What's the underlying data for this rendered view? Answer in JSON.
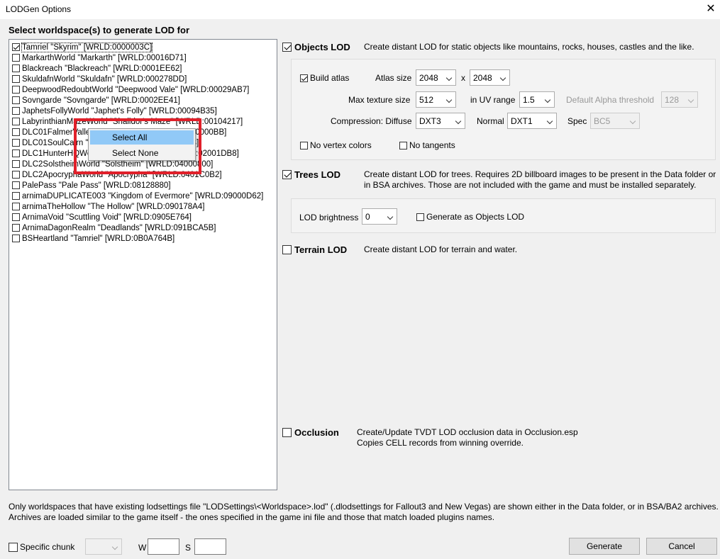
{
  "window": {
    "title": "LODGen Options",
    "close": "✕"
  },
  "worldspaces": {
    "heading": "Select worldspace(s) to generate LOD for",
    "items": [
      {
        "label": "Tamriel \"Skyrim\" [WRLD:0000003C]",
        "checked": true
      },
      {
        "label": "MarkarthWorld \"Markarth\" [WRLD:00016D71]",
        "checked": false
      },
      {
        "label": "Blackreach \"Blackreach\" [WRLD:0001EE62]",
        "checked": false
      },
      {
        "label": "SkuldafnWorld \"Skuldafn\" [WRLD:000278DD]",
        "checked": false
      },
      {
        "label": "DeepwoodRedoubtWorld \"Deepwood Vale\" [WRLD:00029AB7]",
        "checked": false
      },
      {
        "label": "Sovngarde \"Sovngarde\" [WRLD:0002EE41]",
        "checked": false
      },
      {
        "label": "JaphetsFollyWorld \"Japhet's Folly\" [WRLD:00094B35]",
        "checked": false
      },
      {
        "label": "LabyrinthianMazeWorld \"Shalidor's Maze\" [WRLD:00104217]",
        "checked": false
      },
      {
        "label": "DLC01FalmerValley \"Forgotten Vale\" [WRLD:020000BB]",
        "checked": false
      },
      {
        "label": "DLC01SoulCairn \"Soul Cairn\" [WRLD:02001408]",
        "checked": false
      },
      {
        "label": "DLC1HunterHQWorld \"Fort Dawnguard\" [WRLD:02001DB8]",
        "checked": false
      },
      {
        "label": "DLC2SolstheimWorld \"Solstheim\" [WRLD:04000800]",
        "checked": false
      },
      {
        "label": "DLC2ApocryphaWorld \"Apocrypha\" [WRLD:0401C0B2]",
        "checked": false
      },
      {
        "label": "PalePass \"Pale Pass\" [WRLD:08128880]",
        "checked": false
      },
      {
        "label": "arnimaDUPLICATE003 \"Kingdom of Evermore\" [WRLD:09000D62]",
        "checked": false
      },
      {
        "label": "arnimaTheHollow \"The Hollow\" [WRLD:090178A4]",
        "checked": false
      },
      {
        "label": "ArnimaVoid \"Scuttling Void\" [WRLD:0905E764]",
        "checked": false
      },
      {
        "label": "ArnimaDagonRealm \"Deadlands\" [WRLD:091BCA5B]",
        "checked": false
      },
      {
        "label": "BSHeartland \"Tamriel\" [WRLD:0B0A764B]",
        "checked": false
      }
    ]
  },
  "context_menu": {
    "select_all": "Select All",
    "select_none": "Select None"
  },
  "objects_lod": {
    "label": "Objects LOD",
    "checked": true,
    "desc": "Create distant LOD for static objects like mountains, rocks, houses, castles and the like.",
    "build_atlas": "Build atlas",
    "build_atlas_checked": true,
    "atlas_size_label": "Atlas size",
    "atlas_w": "2048",
    "x": "x",
    "atlas_h": "2048",
    "max_tex_label": "Max texture size",
    "max_tex": "512",
    "uv_label": "in UV range",
    "uv": "1.5",
    "alpha_label": "Default Alpha threshold",
    "alpha": "128",
    "comp_label": "Compression: Diffuse",
    "diffuse": "DXT3",
    "normal_label": "Normal",
    "normal": "DXT1",
    "spec_label": "Spec",
    "spec": "BC5",
    "no_vertex": "No vertex colors",
    "no_tangents": "No tangents"
  },
  "trees_lod": {
    "label": "Trees LOD",
    "checked": true,
    "desc1": "Create distant LOD for trees. Requires 2D billboard images to be present in the Data folder or",
    "desc2": "in BSA archives. Those are not included with the game and must be installed separately.",
    "brightness_label": "LOD brightness",
    "brightness": "0",
    "gen_as_objects": "Generate as Objects LOD"
  },
  "terrain_lod": {
    "label": "Terrain LOD",
    "checked": false,
    "desc": "Create distant LOD for terrain and water."
  },
  "occlusion": {
    "label": "Occlusion",
    "checked": false,
    "desc1": "Create/Update TVDT LOD occlusion data in Occlusion.esp",
    "desc2": "Copies CELL records from winning override."
  },
  "info": {
    "line1": "Only worldspaces that have existing lodsettings file \"LODSettings\\<Worldspace>.lod\" (.dlodsettings for Fallout3 and New Vegas) are shown either in the Data folder, or in BSA/BA2 archives.",
    "line2": "Archives are loaded similar to the game itself - the ones specified in the game ini file and those that match loaded plugins names."
  },
  "bottom": {
    "specific_chunk": "Specific chunk",
    "w": "W",
    "s": "S",
    "generate": "Generate",
    "cancel": "Cancel"
  }
}
